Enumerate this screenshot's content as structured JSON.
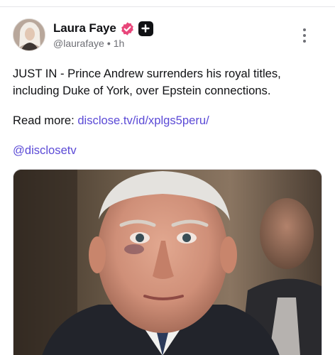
{
  "post": {
    "author": {
      "display_name": "Laura Faye",
      "handle": "@laurafaye",
      "separator": "•",
      "time": "1h",
      "verified_icon": "verified-badge-icon",
      "badge_icon": "plus-badge-icon"
    },
    "menu_icon": "more-vertical-icon",
    "text": {
      "headline": "JUST IN - Prince Andrew surrenders his royal titles, including Duke of York, over Epstein connections.",
      "read_more_label": "Read more:",
      "link": "disclose.tv/id/xplgs5peru/",
      "mention": "@disclosetv"
    },
    "media": {
      "type": "photo",
      "subject": "portrait-photo"
    }
  },
  "colors": {
    "link": "#5b4ad6",
    "text": "#101114",
    "muted": "#6e6f75",
    "verified": "#e8467a",
    "badge": "#101114"
  }
}
